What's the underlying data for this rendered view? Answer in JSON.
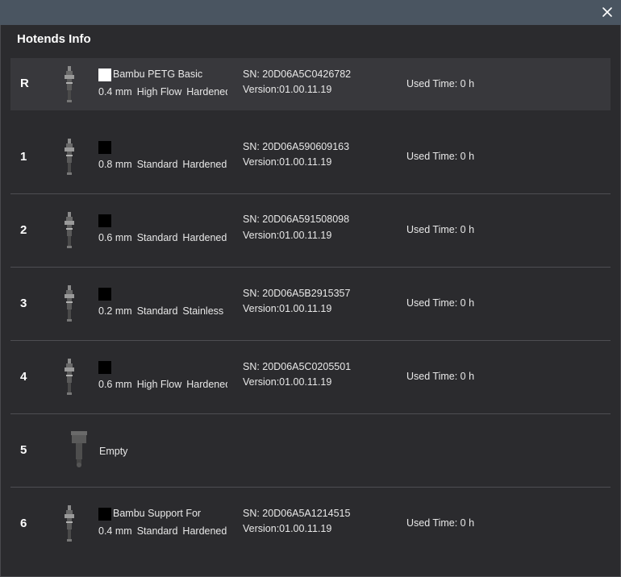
{
  "window": {
    "title": "Hotends Info"
  },
  "hotends": [
    {
      "slot": "R",
      "material": "Bambu PETG Basic",
      "color": "#ffffff",
      "diameter": "0.4 mm",
      "flow": "High Flow",
      "nozzle_type": "Hardened",
      "sn": "SN: 20D06A5C0426782",
      "version": "Version:01.00.11.19",
      "used_time": "Used Time: 0 h",
      "selected": true
    },
    {
      "slot": "1",
      "material": "",
      "color": "#000000",
      "diameter": "0.8 mm",
      "flow": "Standard",
      "nozzle_type": "Hardened",
      "sn": "SN: 20D06A590609163",
      "version": "Version:01.00.11.19",
      "used_time": "Used Time: 0 h"
    },
    {
      "slot": "2",
      "material": "",
      "color": "#000000",
      "diameter": "0.6 mm",
      "flow": "Standard",
      "nozzle_type": "Hardened",
      "sn": "SN: 20D06A591508098",
      "version": "Version:01.00.11.19",
      "used_time": "Used Time: 0 h"
    },
    {
      "slot": "3",
      "material": "",
      "color": "#000000",
      "diameter": "0.2 mm",
      "flow": "Standard",
      "nozzle_type": "Stainless",
      "sn": "SN: 20D06A5B2915357",
      "version": "Version:01.00.11.19",
      "used_time": "Used Time: 0 h"
    },
    {
      "slot": "4",
      "material": "",
      "color": "#000000",
      "diameter": "0.6 mm",
      "flow": "High Flow",
      "nozzle_type": "Hardened",
      "sn": "SN: 20D06A5C0205501",
      "version": "Version:01.00.11.19",
      "used_time": "Used Time: 0 h"
    },
    {
      "slot": "5",
      "empty": true,
      "empty_label": "Empty"
    },
    {
      "slot": "6",
      "material": "Bambu Support For",
      "color": "#000000",
      "diameter": "0.4 mm",
      "flow": "Standard",
      "nozzle_type": "Hardened",
      "sn": "SN: 20D06A5A1214515",
      "version": "Version:01.00.11.19",
      "used_time": "Used Time: 0 h"
    }
  ]
}
